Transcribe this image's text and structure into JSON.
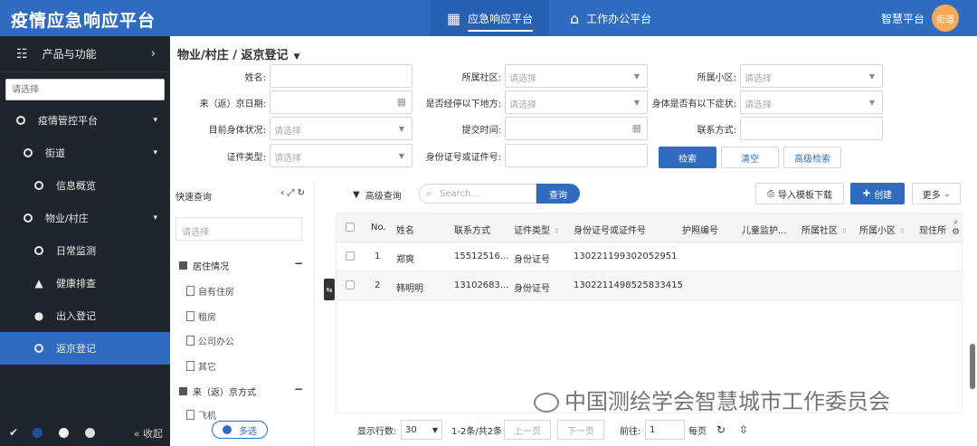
{
  "header": {
    "app_title": "疫情应急响应平台",
    "tabs": [
      {
        "label": "应急响应平台",
        "icon": "apps-icon",
        "active": true
      },
      {
        "label": "工作办公平台",
        "icon": "home-icon",
        "active": false
      }
    ],
    "platform_label": "智慧平台",
    "avatar_text": "街道",
    "colors": {
      "primary": "#2f6cc0",
      "sidebar": "#20242b",
      "avatar": "#f5a95a"
    }
  },
  "sidebar": {
    "product_label": "产品与功能",
    "search_placeholder": "请选择",
    "items": [
      {
        "label": "疫情管控平台",
        "icon": "circle-icon",
        "caret": "⌄"
      },
      {
        "label": "街道",
        "icon": "circle-icon",
        "caret": "⌄"
      },
      {
        "label": "信息概览",
        "icon": "circle-icon"
      },
      {
        "label": "物业/村庄",
        "icon": "circle-icon",
        "caret": "⌄"
      },
      {
        "label": "日常监测",
        "icon": "circle-icon"
      },
      {
        "label": "健康排查",
        "icon": "warning-icon"
      },
      {
        "label": "出入登记",
        "icon": "chat-icon"
      },
      {
        "label": "返京登记",
        "icon": "circle-icon",
        "active": true
      }
    ],
    "collapse_label": "收起"
  },
  "breadcrumb": {
    "title": "物业/村庄 / 返京登记"
  },
  "form": {
    "name_label": "姓名:",
    "community_label": "所属社区:",
    "community_placeholder": "请选择",
    "estate_label": "所属小区:",
    "estate_placeholder": "请选择",
    "return_date_label": "来（返）京日期:",
    "passed_label": "是否经停以下地方:",
    "passed_placeholder": "请选择",
    "symptoms_label": "身体是否有以下症状:",
    "symptoms_placeholder": "请选择",
    "health_label": "目前身体状况:",
    "health_placeholder": "请选择",
    "submit_time_label": "提交时间:",
    "contact_label": "联系方式:",
    "id_type_label": "证件类型:",
    "id_type_placeholder": "请选择",
    "id_number_label": "身份证号或证件号:",
    "search_button": "检索",
    "clear_button": "清空",
    "advanced_button": "高级检索"
  },
  "quick_query": {
    "title": "快速查询",
    "search_placeholder": "请选择",
    "groups": [
      {
        "label": "居住情况",
        "items": [
          "自有住房",
          "租房",
          "公司办公",
          "其它"
        ]
      },
      {
        "label": "来（返）京方式",
        "items": [
          "飞机"
        ]
      }
    ],
    "multi_label": "多选"
  },
  "toolbar": {
    "advanced_query": "高级查询",
    "search_placeholder": "Search...",
    "search_button": "查询",
    "import_button": "导入模板下载",
    "create_button": "创建",
    "more_button": "更多"
  },
  "table": {
    "columns": [
      "No.",
      "姓名",
      "联系方式",
      "证件类型",
      "身份证号或证件号",
      "护照编号",
      "儿童监护...",
      "所属社区",
      "所属小区",
      "现住所"
    ],
    "rows": [
      {
        "no": "1",
        "name": "郑爽",
        "phone": "15512516...",
        "id_type": "身份证号",
        "id_number": "130221199302052951"
      },
      {
        "no": "2",
        "name": "韩明明",
        "phone": "13102683...",
        "id_type": "身份证号",
        "id_number": "130221149852583341​5"
      }
    ]
  },
  "pager": {
    "rows_label": "显示行数:",
    "rows_value": "30",
    "range_text": "1-2条/共2条",
    "prev": "上一页",
    "next": "下一页",
    "goto_label": "前往:",
    "page_value": "1",
    "page_unit": "每页"
  },
  "watermark": {
    "text": "中国测绘学会智慧城市工作委员会"
  }
}
